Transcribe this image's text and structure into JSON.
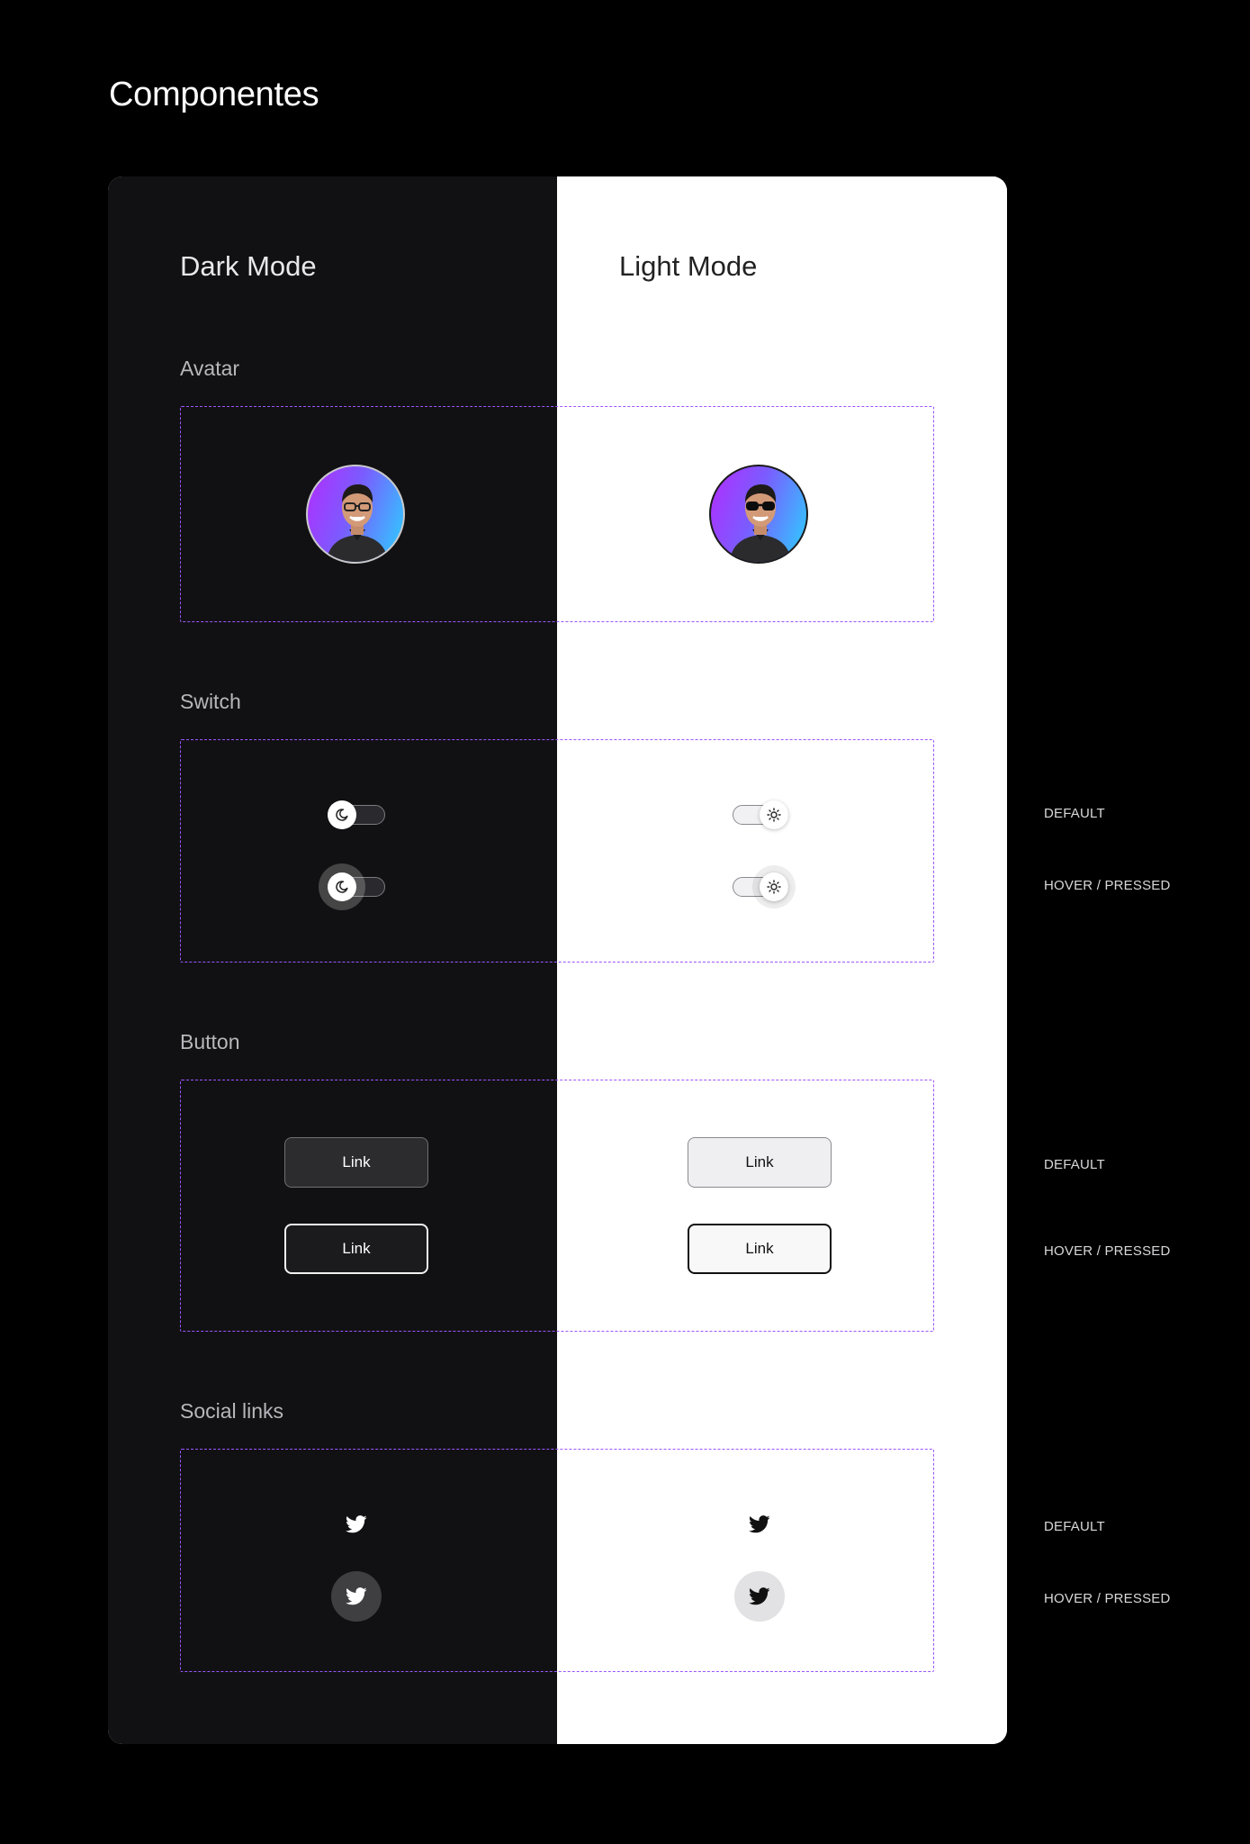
{
  "page": {
    "title": "Componentes"
  },
  "modes": {
    "dark": "Dark Mode",
    "light": "Light Mode"
  },
  "sections": {
    "avatar": {
      "label": "Avatar"
    },
    "switch": {
      "label": "Switch"
    },
    "button": {
      "label": "Button",
      "dark_default": "Link",
      "dark_hover": "Link",
      "light_default": "Link",
      "light_hover": "Link"
    },
    "social": {
      "label": "Social links"
    }
  },
  "states": {
    "switch_default": "DEFAULT",
    "switch_hover": "HOVER / PRESSED",
    "button_default": "DEFAULT",
    "button_hover": "HOVER / PRESSED",
    "social_default": "DEFAULT",
    "social_hover": "HOVER / PRESSED"
  },
  "icons": {
    "switch_dark": "moon-icon",
    "switch_light": "sun-icon",
    "social": "twitter-icon"
  },
  "colors": {
    "accent_dashed": "#9d55ff",
    "dark_panel": "#111113",
    "light_panel": "#ffffff",
    "avatar_gradient": [
      "#b32cff",
      "#7a5cff",
      "#2ad2ff"
    ]
  }
}
